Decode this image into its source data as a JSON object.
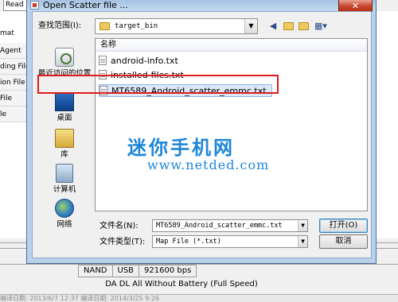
{
  "background_app": {
    "read_tab_label": "Read b",
    "left_items": [
      "mat",
      "Agent",
      "ding File",
      "ion File",
      "File",
      "le"
    ],
    "status_cells": [
      "NAND",
      "USB",
      "921600 bps"
    ],
    "status_line2": "DA DL All Without Battery (Full Speed)",
    "bottom_text": "编译日期: 2013/6/7 12:37                     编译日期: 2014/3/25 9:26"
  },
  "dialog": {
    "title": "Open Scatter file ...",
    "close_label": "✕",
    "look_in_label": "查找范围(I):",
    "look_in_value": "target_bin",
    "toolbar_icons": [
      "back-icon",
      "up-folder-icon",
      "new-folder-icon",
      "view-menu-icon"
    ],
    "places": [
      {
        "label": "最近访问的位置",
        "icon": "recent-places-icon"
      },
      {
        "label": "桌面",
        "icon": "desktop-icon"
      },
      {
        "label": "库",
        "icon": "library-icon"
      },
      {
        "label": "计算机",
        "icon": "computer-icon"
      },
      {
        "label": "网络",
        "icon": "network-icon"
      }
    ],
    "list_header": "名称",
    "files": [
      {
        "name": "android-info.txt"
      },
      {
        "name": "installed-files.txt"
      },
      {
        "name": "MT6589_Android_scatter_emmc.txt",
        "selected": true
      }
    ],
    "filename_label": "文件名(N):",
    "filename_value": "MT6589_Android_scatter_emmc.txt",
    "filetype_label": "文件类型(T):",
    "filetype_value": "Map File (*.txt)",
    "open_button": "打开(O)",
    "cancel_button": "取消"
  },
  "watermark": {
    "title": "迷你手机网",
    "url": "www.netded.com"
  },
  "colors": {
    "highlight": "#e01b1b",
    "watermark": "#1e86d8",
    "dialog_frame": "#b9d1ea"
  }
}
